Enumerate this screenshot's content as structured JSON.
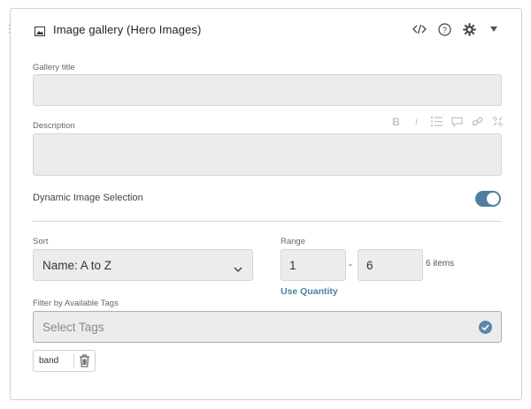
{
  "header": {
    "title": "Image gallery (Hero Images)",
    "icons": [
      "image-icon",
      "code-icon",
      "help-icon",
      "gear-icon",
      "caret-down-icon"
    ]
  },
  "form": {
    "gallery_title_label": "Gallery title",
    "gallery_title_value": "",
    "description_label": "Description",
    "description_value": "",
    "rte_tools": [
      "bold-icon",
      "italic-icon",
      "list-icon",
      "comment-icon",
      "link-icon",
      "unlink-icon"
    ],
    "dynamic_label": "Dynamic Image Selection",
    "dynamic_enabled": true,
    "sort_label": "Sort",
    "sort_value": "Name: A to Z",
    "range_label": "Range",
    "range_from": "1",
    "range_separator": "-",
    "range_to": "6",
    "items_count": "6 items",
    "use_quantity": "Use Quantity",
    "filter_label": "Filter by Available Tags",
    "tags_placeholder": "Select Tags",
    "tags": [
      {
        "label": "band"
      }
    ]
  },
  "colors": {
    "accent": "#4f7fa0",
    "input_bg": "#ececec",
    "border": "#d6d6d6"
  }
}
